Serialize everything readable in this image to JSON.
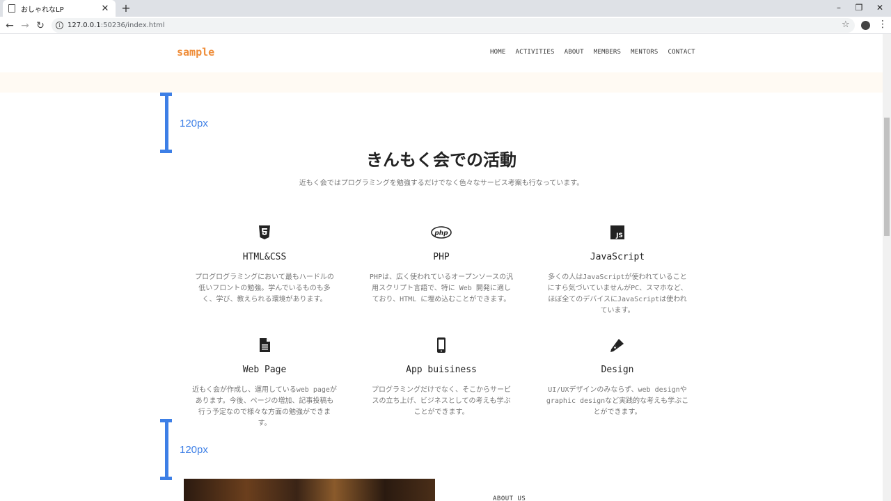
{
  "browser": {
    "tab_title": "おしゃれなLP",
    "new_tab": "+",
    "url_host": "127.0.0.1",
    "url_rest": ":50236/index.html",
    "minimize": "–",
    "restore": "❐",
    "close": "✕"
  },
  "header": {
    "logo": "sample",
    "nav": [
      "HOME",
      "ACTIVITIES",
      "ABOUT",
      "MEMBERS",
      "MENTORS",
      "CONTACT"
    ]
  },
  "spacing_annotations": {
    "top_label": "120px",
    "bottom_label": "120px"
  },
  "section": {
    "title": "きんもく会での活動",
    "subtitle": "近もく会ではプログラミングを勉強するだけでなく色々なサービス考案も行なっています。"
  },
  "cards": [
    {
      "icon": "html5-icon",
      "title": "HTML&CSS",
      "text": "プログログラミングにおいて最もハードルの低いフロントの勉強。学んでいるものも多く、学び、教えられる環境があります。"
    },
    {
      "icon": "php-icon",
      "title": "PHP",
      "text": "PHPは、広く使われているオープンソースの汎用スクリプト言語で、特に Web 開発に適しており、HTML に埋め込むことができます。"
    },
    {
      "icon": "javascript-icon",
      "title": "JavaScript",
      "text": "多くの人はJavaScriptが使われていることにすら気づいていませんがPC、スマホなど、ほぼ全てのデバイスにJavaScriptは使われています。"
    },
    {
      "icon": "document-icon",
      "title": "Web Page",
      "text": "近もく会が作成し、運用しているweb pageがあります。今後、ページの増加、記事投稿も行う予定なので様々な方面の勉強ができます。"
    },
    {
      "icon": "mobile-icon",
      "title": "App buisiness",
      "text": "プログラミングだけでなく、そこからサービスの立ち上げ、ビジネスとしての考えも学ぶことができます。"
    },
    {
      "icon": "pen-icon",
      "title": "Design",
      "text": "UI/UXデザインのみならず、web designやgraphic designなど実践的な考えも学ぶことができます。"
    }
  ],
  "about": {
    "label": "ABOUT US"
  }
}
